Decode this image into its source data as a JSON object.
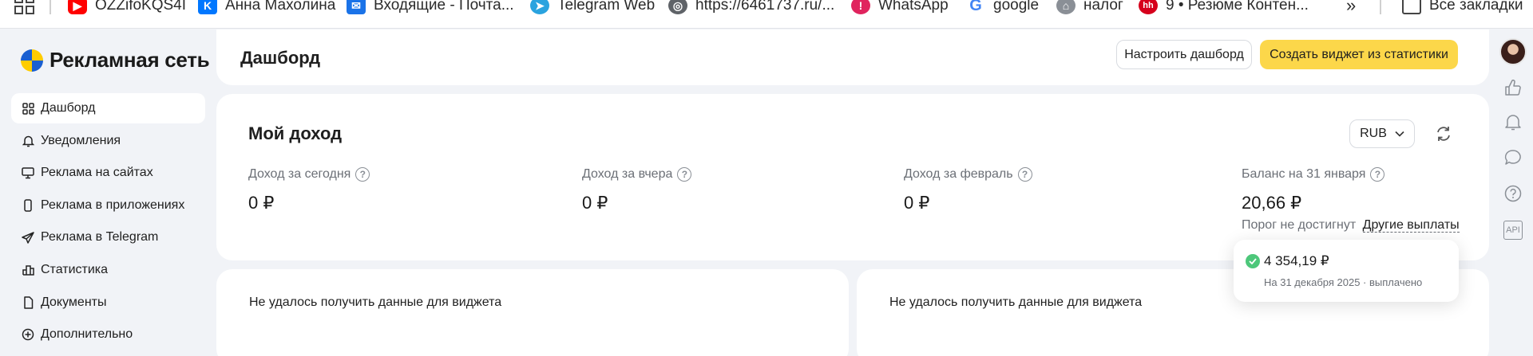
{
  "bookmarks": {
    "items": [
      {
        "label": "OZZifoKQS4I",
        "icon": "youtube-icon",
        "color": "#ff0000"
      },
      {
        "label": "Анна Махолина",
        "icon": "vk-icon",
        "color": "#0077ff"
      },
      {
        "label": "Входящие - Почта...",
        "icon": "mail-icon",
        "color": "#1a73e8"
      },
      {
        "label": "Telegram Web",
        "icon": "telegram-icon",
        "color": "#2aa3df"
      },
      {
        "label": "https://6461737.ru/...",
        "icon": "globe-icon",
        "color": "#5f6368"
      },
      {
        "label": "WhatsApp",
        "icon": "whatsapp-icon",
        "color": "#e0245e"
      },
      {
        "label": "google",
        "icon": "google-icon",
        "color": "#4285f4"
      },
      {
        "label": "налог",
        "icon": "tax-icon",
        "color": "#8a8f96"
      },
      {
        "label": "9 • Резюме Контен...",
        "icon": "hh-icon",
        "color": "#d6001c"
      }
    ],
    "overflow": "»",
    "all_bookmarks": "Все закладки"
  },
  "sidebar": {
    "brand": "Рекламная сеть",
    "items": [
      {
        "label": "Дашборд",
        "icon": "dashboard-icon",
        "active": true
      },
      {
        "label": "Уведомления",
        "icon": "bell-icon"
      },
      {
        "label": "Реклама на сайтах",
        "icon": "monitor-icon"
      },
      {
        "label": "Реклама в приложениях",
        "icon": "phone-icon"
      },
      {
        "label": "Реклама в Telegram",
        "icon": "send-icon"
      },
      {
        "label": "Статистика",
        "icon": "stats-icon"
      },
      {
        "label": "Документы",
        "icon": "document-icon"
      },
      {
        "label": "Дополнительно",
        "icon": "plus-circle-icon"
      }
    ]
  },
  "header": {
    "title": "Дашборд",
    "configure_label": "Настроить дашборд",
    "create_widget_label": "Создать виджет из статистики"
  },
  "income": {
    "title": "Мой доход",
    "currency": "RUB",
    "metrics": [
      {
        "label": "Доход за сегодня",
        "value": "0 ₽"
      },
      {
        "label": "Доход за вчера",
        "value": "0 ₽"
      },
      {
        "label": "Доход за февраль",
        "value": "0 ₽"
      },
      {
        "label": "Баланс на 31 января",
        "value": "20,66 ₽"
      }
    ],
    "threshold_text": "Порог не достигнут",
    "other_payouts": "Другие выплаты"
  },
  "widgets": [
    {
      "message": "Не удалось получить данные для виджета"
    },
    {
      "message": "Не удалось получить данные для виджета"
    }
  ],
  "payout_popover": {
    "amount": "4 354,19 ₽",
    "date": "На 31 декабря 2025",
    "status": "выплачено"
  },
  "rail": {
    "api_label": "API"
  },
  "colors": {
    "accent_yellow": "#fcd74a",
    "success_green": "#4dc77a",
    "background": "#f1f3f7"
  }
}
